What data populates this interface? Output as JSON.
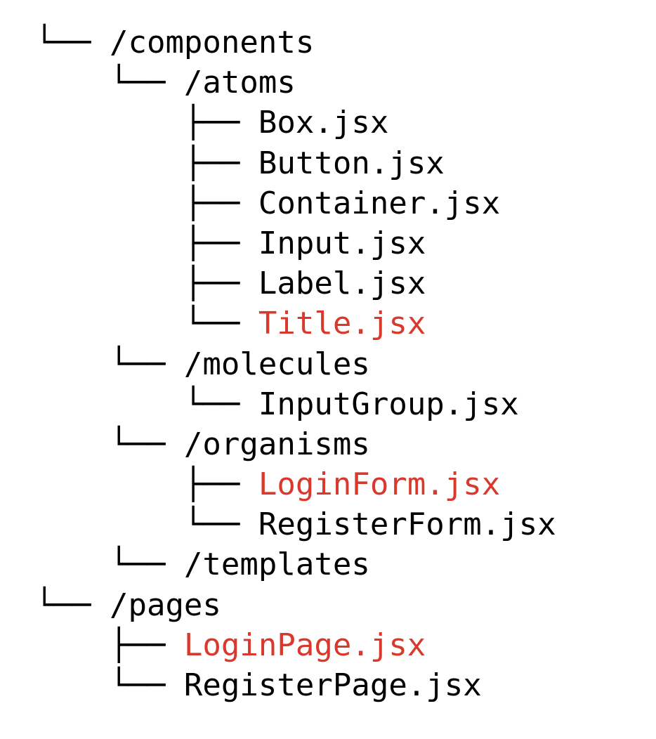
{
  "colors": {
    "text": "#000000",
    "highlight": "#d9392c",
    "background": "#ffffff"
  },
  "tree": [
    {
      "prefix": "└── ",
      "name": "/components",
      "highlight": false
    },
    {
      "prefix": "    └── ",
      "name": "/atoms",
      "highlight": false
    },
    {
      "prefix": "        ├── ",
      "name": "Box.jsx",
      "highlight": false
    },
    {
      "prefix": "        ├── ",
      "name": "Button.jsx",
      "highlight": false
    },
    {
      "prefix": "        ├── ",
      "name": "Container.jsx",
      "highlight": false
    },
    {
      "prefix": "        ├── ",
      "name": "Input.jsx",
      "highlight": false
    },
    {
      "prefix": "        ├── ",
      "name": "Label.jsx",
      "highlight": false
    },
    {
      "prefix": "        └── ",
      "name": "Title.jsx",
      "highlight": true
    },
    {
      "prefix": "    └── ",
      "name": "/molecules",
      "highlight": false
    },
    {
      "prefix": "        └── ",
      "name": "InputGroup.jsx",
      "highlight": false
    },
    {
      "prefix": "    └── ",
      "name": "/organisms",
      "highlight": false
    },
    {
      "prefix": "        ├── ",
      "name": "LoginForm.jsx",
      "highlight": true
    },
    {
      "prefix": "        └── ",
      "name": "RegisterForm.jsx",
      "highlight": false
    },
    {
      "prefix": "    └── ",
      "name": "/templates",
      "highlight": false
    },
    {
      "prefix": "└── ",
      "name": "/pages",
      "highlight": false
    },
    {
      "prefix": "    ├── ",
      "name": "LoginPage.jsx",
      "highlight": true
    },
    {
      "prefix": "    └── ",
      "name": "RegisterPage.jsx",
      "highlight": false
    }
  ]
}
